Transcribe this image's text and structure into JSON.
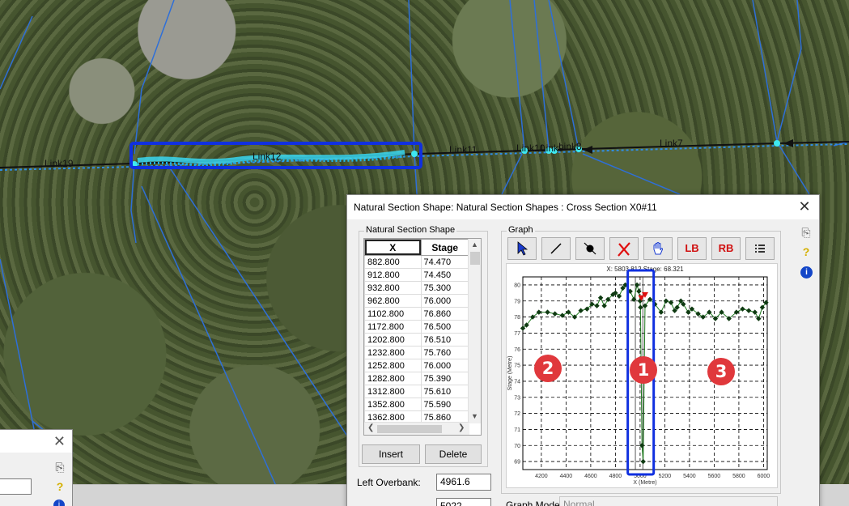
{
  "map": {
    "links": [
      "Link19",
      "Link12",
      "Link11",
      "Link10",
      "Link9",
      "Link8",
      "Link7"
    ]
  },
  "dialog": {
    "title": "Natural Section Shape: Natural Section Shapes : Cross Section X0#11",
    "section_group": "Natural Section Shape",
    "graph_group": "Graph",
    "table": {
      "columns": [
        "X",
        "Stage"
      ],
      "rows": [
        [
          "882.800",
          "74.470"
        ],
        [
          "912.800",
          "74.450"
        ],
        [
          "932.800",
          "75.300"
        ],
        [
          "962.800",
          "76.000"
        ],
        [
          "1102.800",
          "76.860"
        ],
        [
          "1172.800",
          "76.500"
        ],
        [
          "1202.800",
          "76.510"
        ],
        [
          "1232.800",
          "75.760"
        ],
        [
          "1252.800",
          "76.000"
        ],
        [
          "1282.800",
          "75.390"
        ],
        [
          "1312.800",
          "75.610"
        ],
        [
          "1352.800",
          "75.590"
        ],
        [
          "1362.800",
          "75.860"
        ]
      ]
    },
    "insert_label": "Insert",
    "delete_label": "Delete",
    "left_overbank_label": "Left Overbank:",
    "left_overbank_value": "4961.6",
    "right_overbank_value": "5022",
    "graph_mode_label": "Graph Mode",
    "graph_mode_value": "Normal",
    "toolbar": {
      "lb_label": "LB",
      "rb_label": "RB"
    },
    "markers": [
      "1",
      "2",
      "3"
    ]
  },
  "chart_data": {
    "type": "scatter",
    "title": "X: 5803.812 Stage: 68.321",
    "xlabel": "X (Metre)",
    "ylabel": "Stage (Metre)",
    "xlim": [
      4050,
      6030
    ],
    "ylim": [
      68.5,
      80.5
    ],
    "xticks": [
      4200,
      4400,
      4600,
      4800,
      5000,
      5200,
      5400,
      5600,
      5800,
      6000
    ],
    "yticks": [
      69,
      70,
      71,
      72,
      73,
      74,
      75,
      76,
      77,
      78,
      79,
      80
    ],
    "grid": true,
    "series": [
      {
        "color": "#1e7a1e",
        "x": [
          4050,
          4080,
          4130,
          4180,
          4250,
          4310,
          4370,
          4420,
          4470,
          4520,
          4570,
          4610,
          4650,
          4680,
          4710,
          4740,
          4780,
          4800,
          4830,
          4860,
          4880,
          4920,
          4950,
          4975,
          4990,
          5000,
          5003,
          5008,
          5015,
          5025,
          5040,
          5080,
          5120,
          5170,
          5210,
          5250,
          5280,
          5300,
          5330,
          5350,
          5390,
          5420,
          5470,
          5510,
          5560,
          5610,
          5660,
          5720,
          5780,
          5830,
          5880,
          5930,
          5960,
          5990,
          6020
        ],
        "y": [
          77.3,
          77.5,
          78.0,
          78.3,
          78.3,
          78.2,
          78.1,
          78.3,
          78.0,
          78.4,
          78.5,
          78.8,
          78.7,
          79.2,
          78.7,
          79.1,
          79.4,
          79.5,
          79.3,
          79.8,
          80.0,
          79.6,
          79.1,
          80.0,
          79.6,
          79.0,
          78.6,
          75.0,
          70.0,
          69.0,
          78.7,
          79.1,
          78.8,
          78.3,
          79.0,
          78.9,
          78.4,
          78.6,
          79.0,
          78.8,
          78.3,
          78.5,
          78.2,
          78.0,
          78.3,
          77.9,
          78.3,
          77.9,
          78.3,
          78.5,
          78.4,
          78.3,
          77.9,
          78.6,
          78.9
        ]
      }
    ],
    "red_markers": [
      [
        5010,
        79.2
      ],
      [
        5040,
        79.4
      ]
    ],
    "vertical_lines_x": [
      4961.6,
      5022
    ]
  }
}
